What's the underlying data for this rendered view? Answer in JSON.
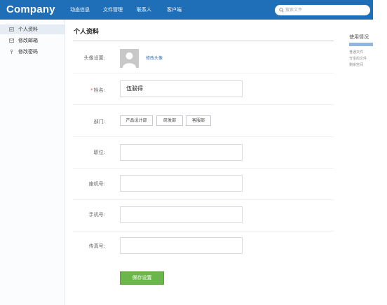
{
  "app": {
    "logo": "Company"
  },
  "nav": [
    {
      "label": "动态信息"
    },
    {
      "label": "文件管理"
    },
    {
      "label": "联系人"
    },
    {
      "label": "客户端"
    }
  ],
  "search": {
    "placeholder": "搜索文件"
  },
  "sidebar": {
    "items": [
      {
        "label": "个人资料",
        "icon": "profile-card-icon",
        "active": true
      },
      {
        "label": "修改邮箱",
        "icon": "envelope-icon",
        "active": false
      },
      {
        "label": "修改密码",
        "icon": "key-icon",
        "active": false
      }
    ]
  },
  "main": {
    "title": "个人资料",
    "avatar": {
      "label": "头像设置:",
      "change_link": "修改头像"
    },
    "name": {
      "label": "姓名:",
      "value": "伍骏得"
    },
    "department": {
      "label": "部门:",
      "options": [
        "产品设计部",
        "研发部",
        "客服部"
      ]
    },
    "position": {
      "label": "职位:",
      "value": ""
    },
    "extension": {
      "label": "座机号:",
      "value": ""
    },
    "mobile": {
      "label": "手机号:",
      "value": ""
    },
    "fax": {
      "label": "传真号:",
      "value": ""
    },
    "save_label": "保存设置"
  },
  "right_panel": {
    "title": "使用情况",
    "lines": [
      "普通文件",
      "分享的文件",
      "剩余空间"
    ]
  },
  "colors": {
    "topbar": "#1e6fb8",
    "save": "#6bb64a",
    "link": "#2e6fb5",
    "required": "#e45c3a"
  }
}
